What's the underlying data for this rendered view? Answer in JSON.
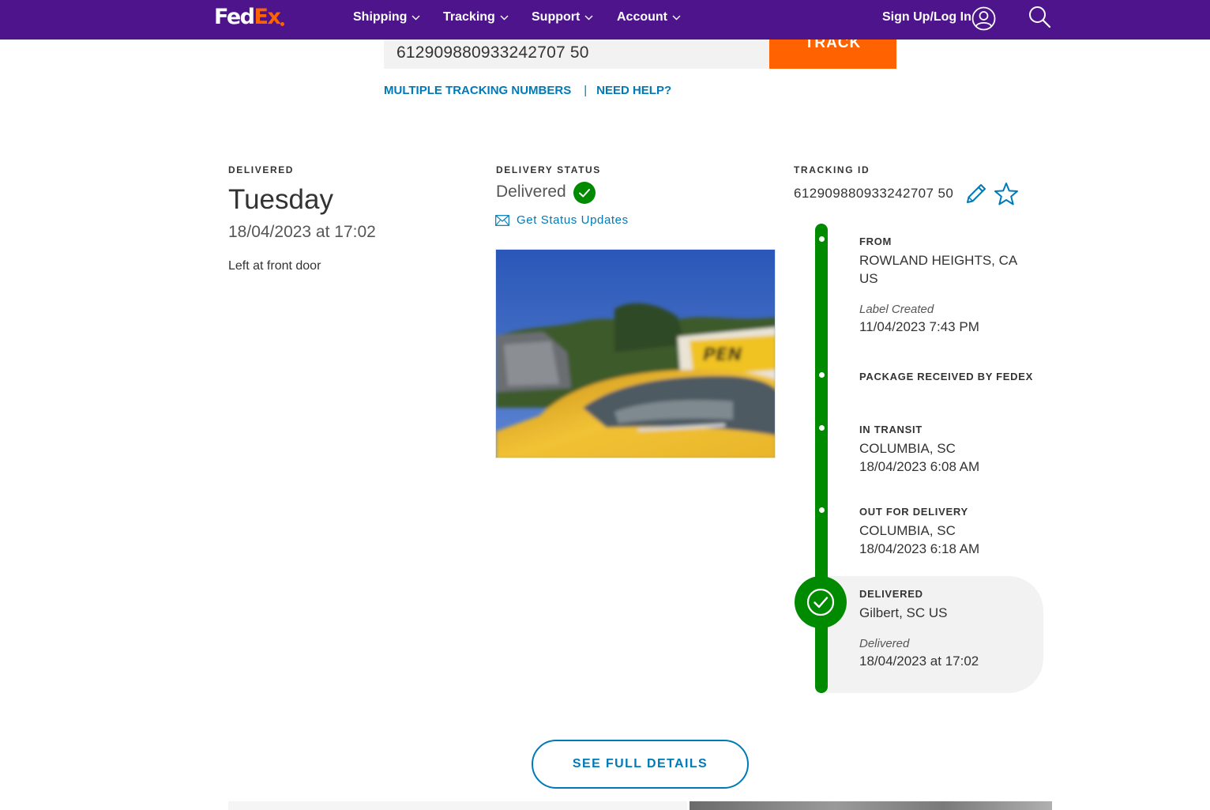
{
  "brand": {
    "logo_part1": "Fed",
    "logo_part2": "Ex",
    "primary_color": "#4d148c",
    "accent_color": "#ff6200",
    "link_color": "#007ab7",
    "status_color": "#008a00"
  },
  "nav": {
    "items": [
      {
        "label": "Shipping"
      },
      {
        "label": "Tracking"
      },
      {
        "label": "Support"
      },
      {
        "label": "Account"
      }
    ],
    "signin_label": "Sign Up/Log In",
    "icons": [
      "user-icon",
      "search-icon"
    ]
  },
  "track": {
    "input_value": "612909880933242707 50",
    "button_label": "TRACK"
  },
  "links": {
    "multiple": "MULTIPLE TRACKING NUMBERS",
    "separator": "|",
    "help": "NEED HELP?"
  },
  "delivered": {
    "heading": "DELIVERED",
    "day": "Tuesday",
    "datetime": "18/04/2023 at 17:02",
    "note": "Left at front door"
  },
  "delivery_status": {
    "heading": "DELIVERY STATUS",
    "status": "Delivered",
    "updates_label": "Get Status Updates"
  },
  "tracking": {
    "heading": "TRACKING ID",
    "id": "612909880933242707 50"
  },
  "timeline": {
    "from": {
      "heading": "FROM",
      "line1": "ROWLAND HEIGHTS, CA",
      "line2": "US",
      "label": "Label Created",
      "datetime": "11/04/2023 7:43 PM"
    },
    "received": {
      "heading": "PACKAGE RECEIVED BY FEDEX"
    },
    "transit": {
      "heading": "IN TRANSIT",
      "location": "COLUMBIA, SC",
      "datetime": "18/04/2023 6:08 AM"
    },
    "out": {
      "heading": "OUT FOR DELIVERY",
      "location": "COLUMBIA, SC",
      "datetime": "18/04/2023 6:18 AM"
    },
    "final": {
      "heading": "DELIVERED",
      "location": "Gilbert, SC US",
      "label": "Delivered",
      "datetime": "18/04/2023 at 17:02"
    }
  },
  "details_button": "SEE FULL DETAILS"
}
